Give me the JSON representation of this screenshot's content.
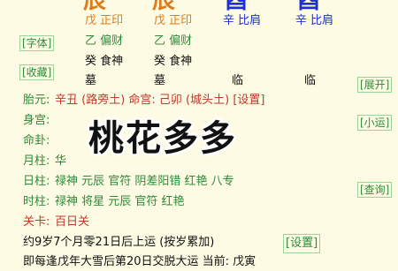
{
  "pillars": {
    "month": "辰",
    "day": "辰",
    "hour": "酉",
    "hour2": "酉"
  },
  "hidden_stems": {
    "col1": [
      "戊 正印",
      "乙 偏财",
      "癸 食神",
      "墓"
    ],
    "col2": [
      "戊 正印",
      "乙 偏财",
      "癸 食神",
      "墓"
    ],
    "col3": [
      "辛 比肩",
      "临"
    ],
    "col4": [
      "辛 比肩",
      "临"
    ]
  },
  "side_buttons": {
    "font": "[字体]",
    "collect": "[收藏]",
    "expand": "[展开]",
    "minor_luck": "[小运]",
    "query": "[查询]"
  },
  "rows": [
    {
      "label": "胎元:",
      "value": "辛丑 (路旁土)  命宫: 己卯 (城头土) [设置]"
    },
    {
      "label": "身宫:",
      "value": ""
    },
    {
      "label": "命卦:",
      "value": ""
    },
    {
      "label": "月柱:",
      "value": "华"
    },
    {
      "label": "日柱:",
      "value": "禄神 元辰 官符 阴差阳错 红艳 八专"
    },
    {
      "label": "时柱:",
      "value": "禄神 将星 元辰 官符 红艳"
    },
    {
      "label": "关卡:",
      "value": "百日关"
    }
  ],
  "overlay_text": "桃花多多",
  "luck_line": "约9岁7个月零21日后上运 (按岁累加)",
  "luck_settings": "[设置]",
  "bottom_line": "即每逢戊年大雪后第20日交脱大运 当前: 戊寅"
}
